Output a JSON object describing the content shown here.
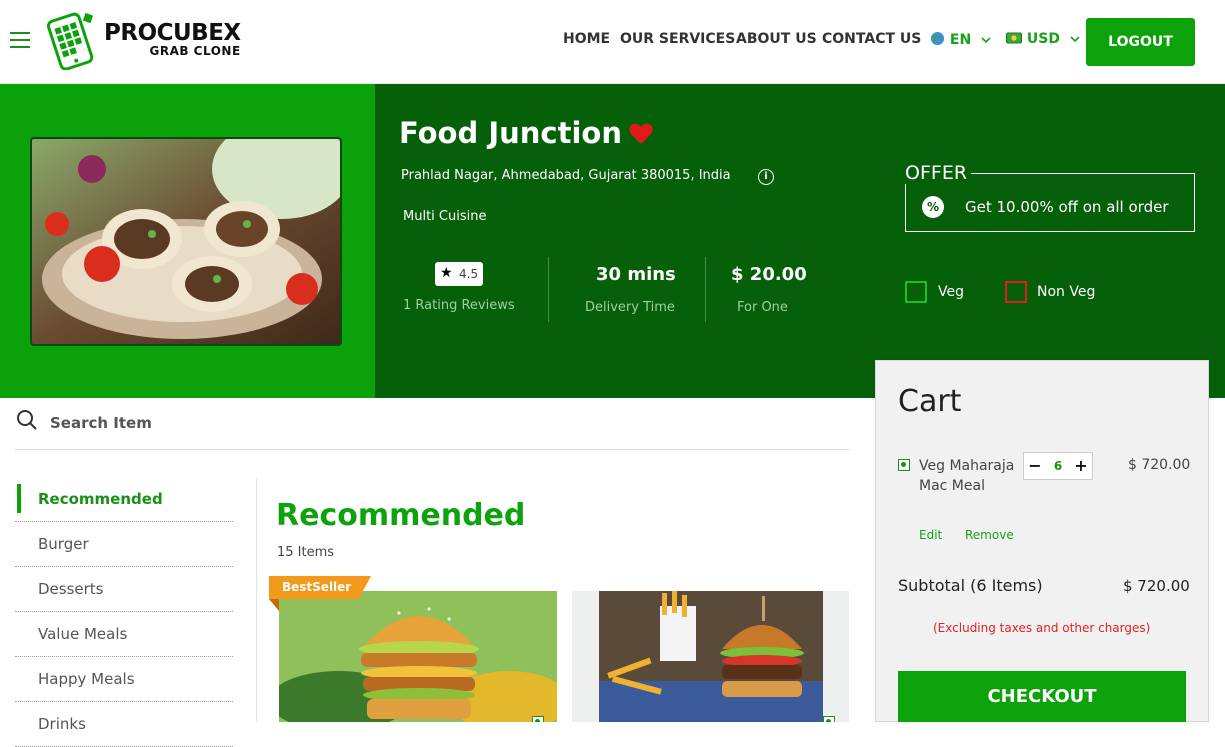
{
  "header": {
    "brand": "PROCUBEX",
    "brand_sub": "GRAB CLONE",
    "nav": [
      "HOME",
      "OUR SERVICES",
      "ABOUT US",
      "CONTACT US"
    ],
    "language": "EN",
    "currency": "USD",
    "logout_label": "LOGOUT"
  },
  "restaurant": {
    "name": "Food Junction",
    "address": "Prahlad Nagar, Ahmedabad, Gujarat 380015, India",
    "cuisine": "Multi Cuisine",
    "rating": "4.5",
    "rating_reviews": "1 Rating Reviews",
    "delivery_time": "30 mins",
    "delivery_label": "Delivery Time",
    "price_for_one": "$ 20.00",
    "price_label": "For One"
  },
  "offer": {
    "label": "OFFER",
    "text": "Get 10.00% off on all order"
  },
  "filters": {
    "veg": "Veg",
    "non_veg": "Non Veg"
  },
  "search": {
    "placeholder": "Search Item"
  },
  "categories": [
    "Recommended",
    "Burger",
    "Desserts",
    "Value Meals",
    "Happy Meals",
    "Drinks"
  ],
  "section": {
    "title": "Recommended",
    "count": "15 Items",
    "badge": "BestSeller"
  },
  "cart": {
    "title": "Cart",
    "item_name": "Veg Maharaja Mac Meal",
    "quantity": "6",
    "item_price": "$ 720.00",
    "edit_label": "Edit",
    "remove_label": "Remove",
    "subtotal_label": "Subtotal (6 Items)",
    "subtotal_value": "$ 720.00",
    "tax_note": "(Excluding taxes and other charges)",
    "checkout_label": "CHECKOUT"
  },
  "colors": {
    "primary_green": "#0ca20c",
    "dark_green": "#06600a",
    "accent_orange": "#f39a1c",
    "heart_red": "#e0191c"
  }
}
